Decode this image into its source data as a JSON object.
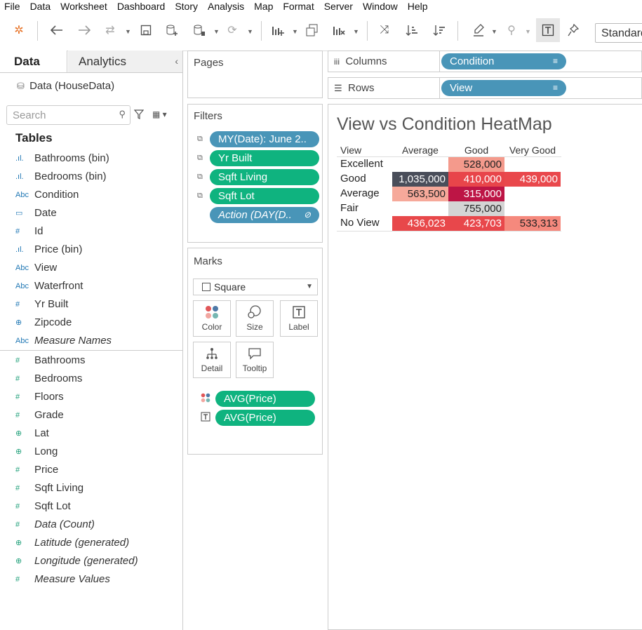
{
  "menu": [
    "File",
    "Data",
    "Worksheet",
    "Dashboard",
    "Story",
    "Analysis",
    "Map",
    "Format",
    "Server",
    "Window",
    "Help"
  ],
  "toolbar": {
    "standard_label": "Standard"
  },
  "left_pane": {
    "tab_data": "Data",
    "tab_analytics": "Analytics",
    "collapse": "‹",
    "source": "Data (HouseData)",
    "search_placeholder": "Search",
    "tables_heading": "Tables",
    "dimensions": [
      {
        "icon": ".ıl.",
        "label": "Bathrooms (bin)"
      },
      {
        "icon": ".ıl.",
        "label": "Bedrooms (bin)"
      },
      {
        "icon": "Abc",
        "label": "Condition"
      },
      {
        "icon": "▭",
        "label": "Date"
      },
      {
        "icon": "#",
        "label": "Id"
      },
      {
        "icon": ".ıl.",
        "label": "Price (bin)"
      },
      {
        "icon": "Abc",
        "label": "View"
      },
      {
        "icon": "Abc",
        "label": "Waterfront"
      },
      {
        "icon": "#",
        "label": "Yr Built"
      },
      {
        "icon": "⊕",
        "label": "Zipcode"
      },
      {
        "icon": "Abc",
        "label": "Measure Names"
      }
    ],
    "measures": [
      {
        "icon": "#",
        "label": "Bathrooms"
      },
      {
        "icon": "#",
        "label": "Bedrooms"
      },
      {
        "icon": "#",
        "label": "Floors"
      },
      {
        "icon": "#",
        "label": "Grade"
      },
      {
        "icon": "⊕",
        "label": "Lat"
      },
      {
        "icon": "⊕",
        "label": "Long"
      },
      {
        "icon": "#",
        "label": "Price"
      },
      {
        "icon": "#",
        "label": "Sqft Living"
      },
      {
        "icon": "#",
        "label": "Sqft Lot"
      },
      {
        "icon": "#",
        "label": "Data (Count)"
      },
      {
        "icon": "⊕",
        "label": "Latitude (generated)"
      },
      {
        "icon": "⊕",
        "label": "Longitude (generated)"
      },
      {
        "icon": "#",
        "label": "Measure Values"
      }
    ]
  },
  "pages": {
    "title": "Pages"
  },
  "filters": {
    "title": "Filters",
    "pills": [
      "MY(Date): June 2..",
      "Yr Built",
      "Sqft Living",
      "Sqft Lot",
      "Action (DAY(D.."
    ]
  },
  "marks": {
    "title": "Marks",
    "type": "Square",
    "buttons": [
      "Color",
      "Size",
      "Label",
      "Detail",
      "Tooltip"
    ],
    "pills": [
      "AVG(Price)",
      "AVG(Price)"
    ]
  },
  "shelves": {
    "columns_label": "Columns",
    "rows_label": "Rows",
    "columns_pill": "Condition",
    "rows_pill": "View"
  },
  "chart_data": {
    "type": "heatmap",
    "title": "View vs Condition HeatMap",
    "row_header": "View",
    "columns": [
      "Average",
      "Good",
      "Very Good"
    ],
    "rows": [
      {
        "label": "Excellent",
        "cells": [
          null,
          "528,000",
          null
        ]
      },
      {
        "label": "Good",
        "cells": [
          "1,035,000",
          "410,000",
          "439,000"
        ]
      },
      {
        "label": "Average",
        "cells": [
          "563,500",
          "315,000",
          null
        ]
      },
      {
        "label": "Fair",
        "cells": [
          null,
          "755,000",
          null
        ]
      },
      {
        "label": "No View",
        "cells": [
          "436,023",
          "423,703",
          "533,313"
        ]
      }
    ],
    "values": [
      [
        null,
        528000,
        null
      ],
      [
        1035000,
        410000,
        439000
      ],
      [
        563500,
        315000,
        null
      ],
      [
        null,
        755000,
        null
      ],
      [
        436023,
        423703,
        533313
      ]
    ],
    "colors": [
      [
        null,
        "#f49a8c",
        null
      ],
      [
        "#4a4e5a",
        "#e8454a",
        "#e9484c"
      ],
      [
        "#f6a99a",
        "#bd1545",
        null
      ],
      [
        null,
        "#d4d4d4",
        null
      ],
      [
        "#e8484a",
        "#e8474b",
        "#f5897d"
      ]
    ],
    "text_colors": [
      [
        null,
        "#222",
        null
      ],
      [
        "#fff",
        "#fff",
        "#fff"
      ],
      [
        "#222",
        "#fff",
        null
      ],
      [
        null,
        "#222",
        null
      ],
      [
        "#fff",
        "#fff",
        "#222"
      ]
    ]
  }
}
